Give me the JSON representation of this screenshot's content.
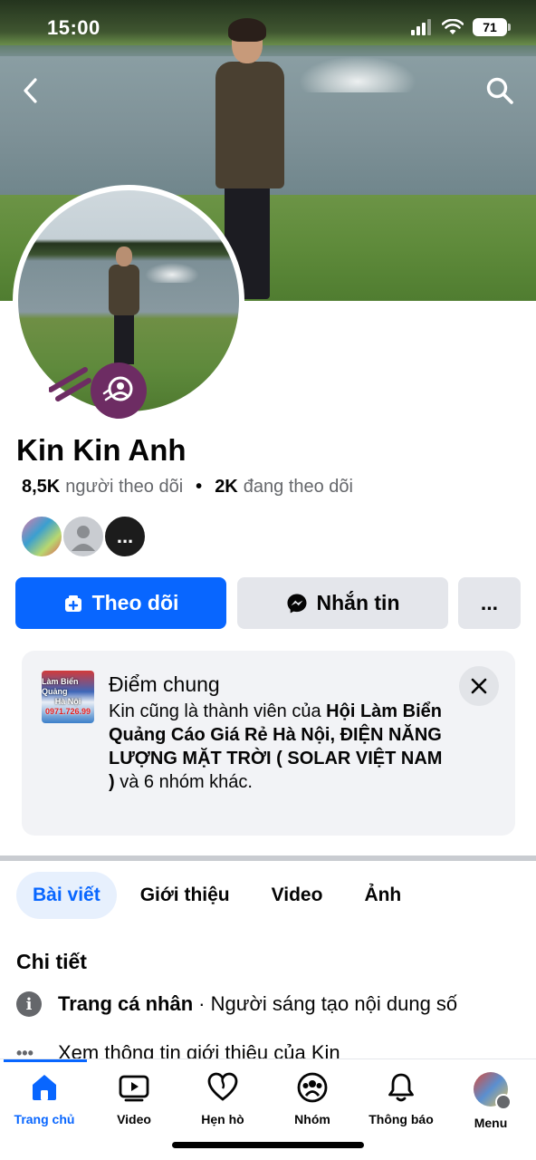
{
  "status_bar": {
    "time": "15:00",
    "battery": "71"
  },
  "profile": {
    "name": "Kin Kin Anh",
    "followers_count": "8,5K",
    "followers_label": "người theo dõi",
    "following_count": "2K",
    "following_label": "đang theo dõi",
    "more_mutuals": "..."
  },
  "actions": {
    "follow_label": "Theo dõi",
    "message_label": "Nhắn tin",
    "more_label": "..."
  },
  "common_card": {
    "title": "Điểm chung",
    "text_prefix": "Kin cũng là thành viên của ",
    "group1": "Hội Làm Biển Quảng Cáo Giá Rẻ Hà Nội,",
    "group2": "ĐIỆN NĂNG LƯỢNG MẶT TRỜI ( SOLAR VIỆT NAM )",
    "text_suffix": " và 6 nhóm khác.",
    "thumb_line1": "Làm Biển Quảng",
    "thumb_line2": "Hà Nội",
    "thumb_phone": "0971.726.99"
  },
  "tabs": [
    {
      "label": "Bài viết",
      "active": true
    },
    {
      "label": "Giới thiệu",
      "active": false
    },
    {
      "label": "Video",
      "active": false
    },
    {
      "label": "Ảnh",
      "active": false
    }
  ],
  "details": {
    "title": "Chi tiết",
    "row1_bold": "Trang cá nhân",
    "row1_text": "· Người sáng tạo nội dung số",
    "row2_text": "Xem thông tin giới thiệu của Kin"
  },
  "bottom_nav": [
    {
      "label": "Trang chủ",
      "icon": "home-icon",
      "active": true
    },
    {
      "label": "Video",
      "icon": "video-icon",
      "active": false
    },
    {
      "label": "Hẹn hò",
      "icon": "dating-heart-icon",
      "active": false
    },
    {
      "label": "Nhóm",
      "icon": "groups-icon",
      "active": false
    },
    {
      "label": "Thông báo",
      "icon": "bell-icon",
      "active": false
    },
    {
      "label": "Menu",
      "icon": "menu-avatar-icon",
      "active": false
    }
  ],
  "colors": {
    "primary": "#0866ff",
    "secondary_button": "#e4e6eb",
    "card_background": "#f2f3f6",
    "text_secondary": "#65676b",
    "badge": "#6d2c63"
  }
}
